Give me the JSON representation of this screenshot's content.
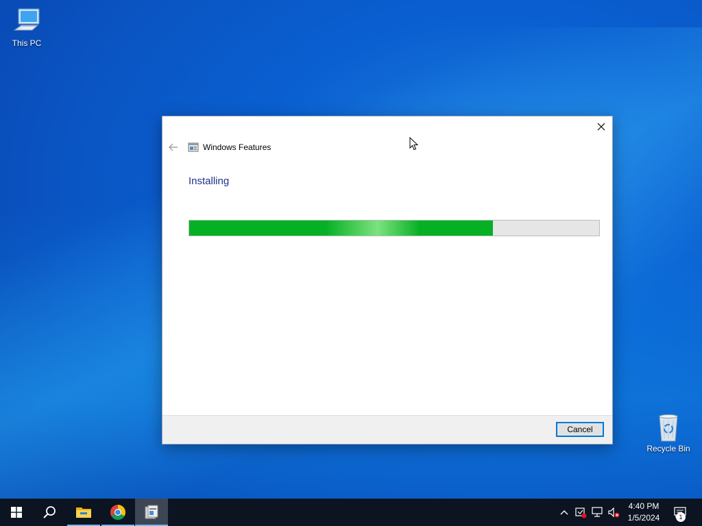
{
  "desktop": {
    "icons": [
      {
        "label": "This PC"
      },
      {
        "label": "Recycle Bin"
      }
    ]
  },
  "dialog": {
    "title": "Windows Features",
    "heading": "Installing",
    "progress_fraction": 0.74,
    "cancel_label": "Cancel"
  },
  "taskbar": {
    "apps": [
      {
        "name": "start-icon"
      },
      {
        "name": "search-icon"
      },
      {
        "name": "file-explorer-icon"
      },
      {
        "name": "chrome-icon"
      },
      {
        "name": "windows-features-icon"
      }
    ],
    "clock": {
      "time": "4:40 PM",
      "date": "1/5/2024"
    },
    "notification_count": "1"
  },
  "colors": {
    "accent": "#0078d7",
    "progress_green": "#06b025",
    "heading_blue": "#1e3287"
  }
}
